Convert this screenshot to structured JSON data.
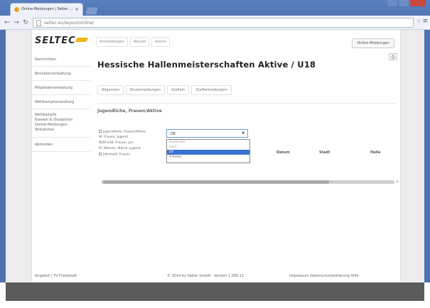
{
  "browser": {
    "tab_title": "Online-Meldungen | Seltec ...",
    "url": "seltec.eu/layout/online/"
  },
  "header": {
    "logo": "SELTEC",
    "nav": [
      "Anmeldungen",
      "Aktuell",
      "Archiv"
    ],
    "online_button": "Online-Meldungen"
  },
  "sidebar": {
    "items": [
      "Nachrichten",
      "Benutzerverwaltung",
      "Mitgliederverwaltung",
      "Wettkampfverwaltung",
      "Wettkämpfe\nKlassen & Disziplinen\nOnline-Meldungen\nTeilnehmer",
      "Abmelden"
    ]
  },
  "main": {
    "title": "Hessische Hallenmeisterschaften Aktive / U18",
    "tabs": [
      "Allgemein",
      "Einzelmeldungen",
      "Staffeln",
      "Staffelmeldungen"
    ],
    "section_title": "Jugendliche, Frauen/Aktive"
  },
  "left_panel": {
    "rows": [
      "Jugendliche, Frauen/Aktive",
      "W: Frauen, Jugend",
      "W/M U18: Frauen, Jun.",
      "M: Männer, Männl. Jugend",
      "Jahrmeld. Frauen"
    ]
  },
  "select": {
    "value": "DE",
    "options": [
      "Ausländer",
      "Gast",
      "DE",
      "A-Kader"
    ],
    "selected_index": 2
  },
  "table": {
    "columns": [
      "Datum",
      "Stadt",
      "Halle"
    ]
  },
  "footer": {
    "left": "Angebot | TV Friedstadt",
    "center": "© 2014 by Seltec GmbH · Version 1.000.11",
    "right": "Impressum   Datenschutzerklärung   Hilfe"
  }
}
